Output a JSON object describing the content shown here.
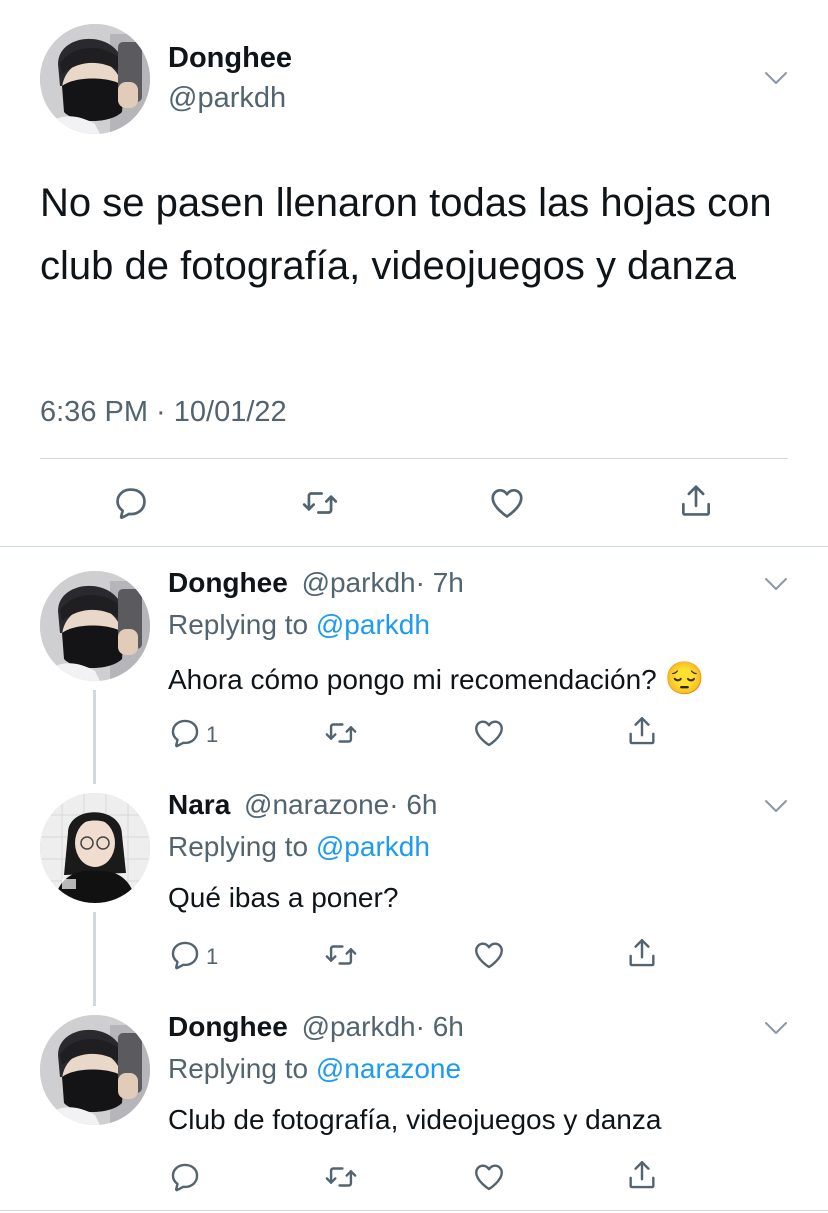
{
  "main_tweet": {
    "display_name": "Donghee",
    "handle": "@parkdh",
    "text": "No se pasen llenaron todas las hojas con club de fotografía, videojuegos y danza",
    "timestamp": "6:36 PM · 10/01/22"
  },
  "replies": [
    {
      "display_name": "Donghee",
      "handle": "@parkdh",
      "time": "· 7h",
      "replying_prefix": "Replying to",
      "replying_to": "@parkdh",
      "text": "Ahora cómo pongo mi recomendación?",
      "emoji": "😔",
      "reply_count": "1"
    },
    {
      "display_name": "Nara",
      "handle": "@narazone",
      "time": "· 6h",
      "replying_prefix": "Replying to",
      "replying_to": "@parkdh",
      "text": "Qué ibas a poner?",
      "reply_count": "1"
    },
    {
      "display_name": "Donghee",
      "handle": "@parkdh",
      "time": "· 6h",
      "replying_prefix": "Replying to",
      "replying_to": "@narazone",
      "text": "Club de fotografía, videojuegos y danza",
      "reply_count": ""
    }
  ],
  "colors": {
    "link": "#1d9bf0",
    "muted": "#536471",
    "text": "#0f1419",
    "divider": "#cfd9de"
  },
  "icons": [
    "chevron-down-icon",
    "reply-icon",
    "retweet-icon",
    "like-icon",
    "share-icon"
  ]
}
